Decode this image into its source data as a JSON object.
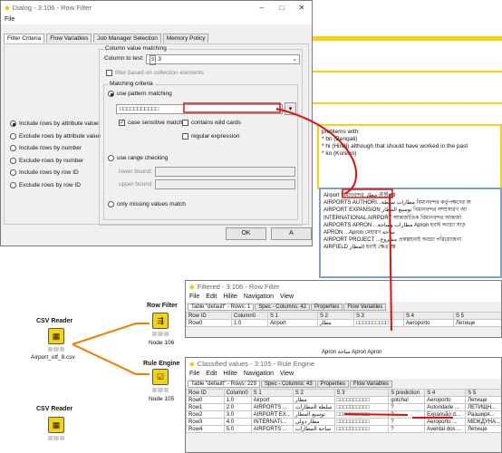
{
  "dialog": {
    "title": "Dialog - 3:106 - Row Filter",
    "menu": "File",
    "tabs": [
      "Filter Criteria",
      "Flow Variables",
      "Job Manager Selection",
      "Memory Policy"
    ],
    "filter_options": [
      {
        "label": "Include rows by attribute value",
        "selected": true
      },
      {
        "label": "Exclude rows by attribute value",
        "selected": false
      },
      {
        "label": "Include rows by number",
        "selected": false
      },
      {
        "label": "Exclude rows by number",
        "selected": false
      },
      {
        "label": "Include rows by row ID",
        "selected": false
      },
      {
        "label": "Exclude rows by row ID",
        "selected": false
      }
    ],
    "column_value_matching": "Column value matching",
    "column_to_test_label": "Column to test:",
    "column_to_test_value": "3",
    "filter_collection": "filter based on collection elements",
    "matching_criteria": "Matching criteria",
    "use_pattern": "use pattern matching",
    "pattern_value": "□□□□□□□□□□□",
    "case_sensitive": "case sensitive match",
    "contains_wildcards": "contains wild cards",
    "regex": "regular expression",
    "use_range": "use range checking",
    "lower_bound": "lower bound:",
    "upper_bound": "upper bound:",
    "only_missing": "only missing values match",
    "ok": "OK",
    "apply": "A"
  },
  "note": {
    "lines": [
      "problems with:",
      "* bn (Bengali)",
      "* hi (Hindi) although that should have worked in the past",
      "* ko (Korean)"
    ]
  },
  "bg_table": {
    "rows": [
      "Airport  বিমানবন্দর مطار 공항 ह्ड",
      "AIRPORTS AUTHORI...مطارات سلطة বিমানবন্দর কর্তৃপক্ষদের অ",
      "AIRPORT EXPANSION  توسيع المطار বিমানবন্দর সম্প্রসারণ আ",
      "INTERNATIONAL AIRPORT আন্তর্জাতিক বিমানবন্দর আন্তর্জা",
      "AIRPORTS APRON ...مطارات وساحة Apron হবাই অড্ডা সাড়",
      "APRON  ...Apron মেহারণ ساحة",
      "AIRPORT PROJECT ...مشروع প্রকল্পহবাই অড্ডা পরিয়োজনা",
      "AIRFIELD  المطار হবাই ক্ষেত্র ह्ड"
    ],
    "extra_row": "Apron  ساحة  Apron  Apron"
  },
  "filtered": {
    "title": "Filtered - 3:106 - Row Filter",
    "menu": [
      "File",
      "Edit",
      "Hilite",
      "Navigation",
      "View"
    ],
    "tabs": [
      "Table \"default\" - Rows: 1",
      "Spec - Columns: 42",
      "Properties",
      "Flow Variables"
    ],
    "headers": [
      "Row ID",
      "Column0",
      "S 1",
      "S 2",
      "S 3",
      "S 4",
      "S 5"
    ],
    "rows": [
      [
        "Row0",
        "1.0",
        "Airport",
        "مطار",
        "□□□□□□□□□□",
        "Aeroporto",
        "Летище"
      ]
    ]
  },
  "classified": {
    "title": "Classified values - 3:105 - Rule Engine",
    "menu": [
      "File",
      "Edit",
      "Hilite",
      "Navigation",
      "View"
    ],
    "tabs": [
      "Table \"default\" - Rows: 229",
      "Spec - Columns: 43",
      "Properties",
      "Flow Variables"
    ],
    "headers": [
      "Row ID",
      "Column0",
      "S 1",
      "S 2",
      "S 3",
      "S prediction",
      "S 4",
      "S 5"
    ],
    "rows": [
      [
        "Row0",
        "1.0",
        "Airport",
        "مطار",
        "□□□□□□□□□□",
        "gotcha!",
        "Aeroporto",
        "Летище"
      ],
      [
        "Row1",
        "2.0",
        "AIRPORTS ...",
        "سلطة المطارات",
        "□□□□□□□□□□",
        "?",
        "Autoridade ...",
        "ЛЕТИЩН..."
      ],
      [
        "Row2",
        "3.0",
        "AIRPORT EX...",
        "توسيع المطار",
        "□□□□□□□□□□",
        "?",
        "Expansão d...",
        "Разширя..."
      ],
      [
        "Row3",
        "4.0",
        "INTERNATI...",
        "مطار دولي",
        "□□□□□□□□□□",
        "?",
        "Aeroporto ...",
        "МЕЖДУНА..."
      ],
      [
        "Row4",
        "5.0",
        "AIRPORTS ...",
        "ساحة المطارات",
        "□□□□□□□□□□",
        "?",
        "Avental dos ...",
        "Летище"
      ]
    ]
  },
  "nodes": [
    {
      "name": "CSV Reader",
      "sub": "Airport_utf_8.csv"
    },
    {
      "name": "Row Filter",
      "sub": "Node 106"
    },
    {
      "name": "Rule Engine",
      "sub": "Node 105"
    },
    {
      "name": "CSV Reader",
      "sub": ""
    }
  ],
  "colors": {
    "highlight_red": "#e01010",
    "yellow": "#f5d40f",
    "table_blue": "#7fa2cc"
  }
}
